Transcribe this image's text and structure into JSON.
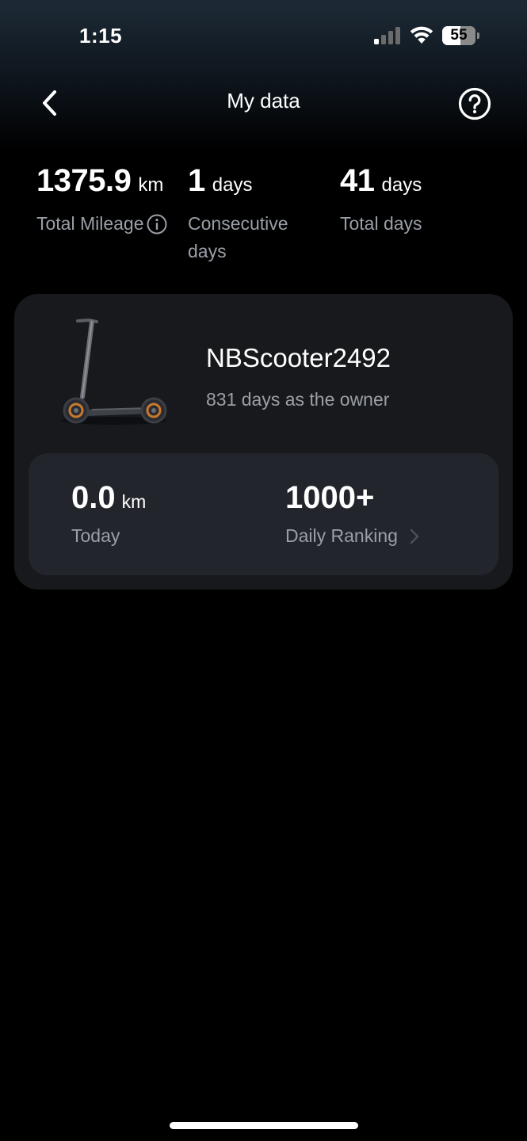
{
  "status_bar": {
    "time": "1:15",
    "battery_percent": "55",
    "battery_level": 0.55,
    "signal_icon": "cellular-signal-icon",
    "wifi_icon": "wifi-icon",
    "battery_icon": "battery-icon"
  },
  "nav": {
    "title": "My data",
    "back_icon": "chevron-left-icon",
    "help_icon": "question-circle-icon"
  },
  "stats": {
    "total_mileage": {
      "value": "1375.9",
      "unit": "km",
      "label": "Total Mileage",
      "icon": "info-icon"
    },
    "consecutive_days": {
      "value": "1",
      "unit": "days",
      "label": "Consecutive days"
    },
    "total_days": {
      "value": "41",
      "unit": "days",
      "label": "Total days"
    }
  },
  "scooter": {
    "name": "NBScooter2492",
    "owner_text": "831 days as the owner",
    "image_icon": "scooter-icon",
    "today": {
      "value": "0.0",
      "unit": "km",
      "label": "Today"
    },
    "ranking": {
      "value": "1000+",
      "label": "Daily Ranking",
      "icon": "chevron-right-icon"
    }
  },
  "colors": {
    "background": "#000000",
    "card": "#18191d",
    "inner_card": "#22252b",
    "secondary_text": "#9a9fa7",
    "accent_orange": "#c77a2c"
  }
}
